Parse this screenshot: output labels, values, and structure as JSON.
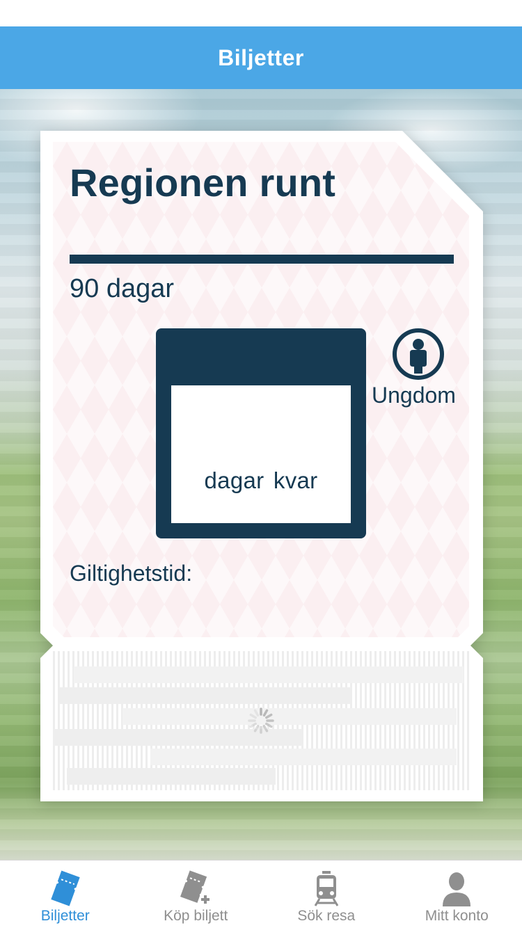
{
  "header": {
    "title": "Biljetter"
  },
  "ticket": {
    "title": "Regionen runt",
    "duration": "90 dagar",
    "days_left_label": "dagar  kvar",
    "category": "Ungdom",
    "validity_label": "Giltighetstid:"
  },
  "tabs": [
    {
      "label": "Biljetter",
      "icon": "ticket-icon",
      "active": true
    },
    {
      "label": "Köp biljett",
      "icon": "buy-ticket-icon",
      "active": false
    },
    {
      "label": "Sök resa",
      "icon": "train-icon",
      "active": false
    },
    {
      "label": "Mitt konto",
      "icon": "account-icon",
      "active": false
    }
  ],
  "colors": {
    "brand_blue": "#4ba7e6",
    "ticket_navy": "#163a52",
    "active_tab": "#2f8fd8",
    "inactive_tab": "#8f8f8f"
  }
}
